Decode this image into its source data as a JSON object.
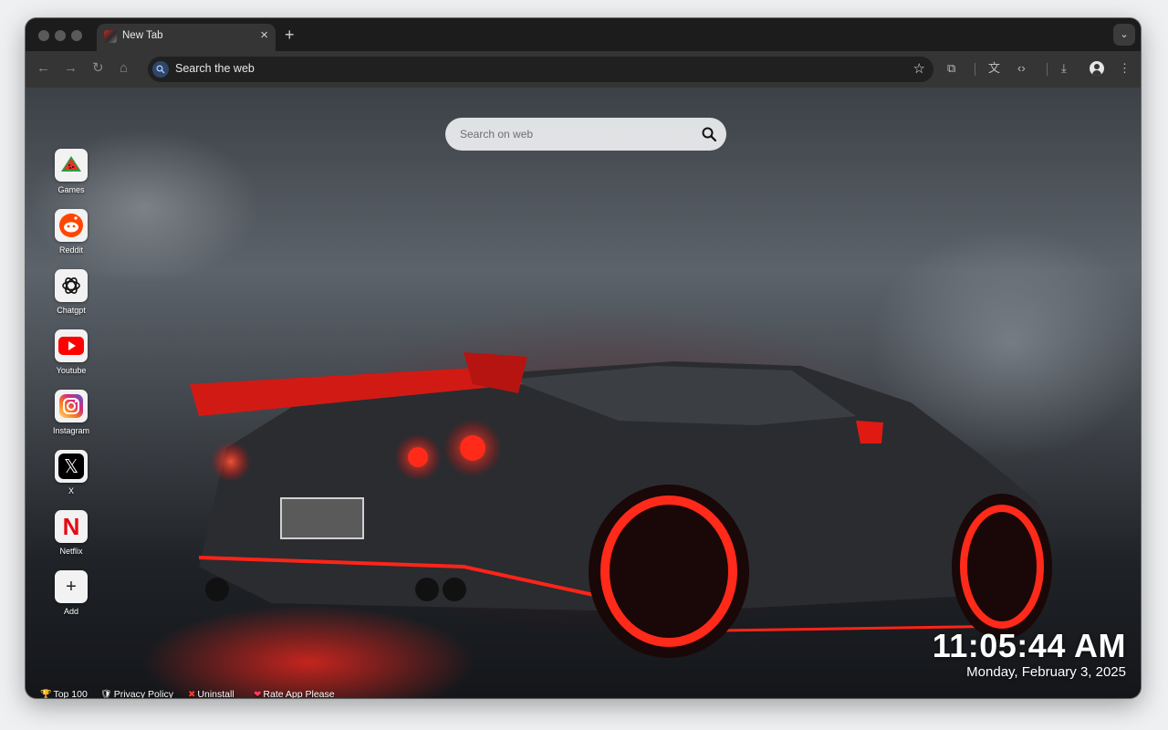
{
  "browser": {
    "tab": {
      "title": "New Tab",
      "close_glyph": "×"
    },
    "new_tab_glyph": "+",
    "tab_search_glyph": "⌄",
    "omnibox": {
      "text": "Search the web",
      "star_glyph": "☆"
    },
    "nav": {
      "back": "←",
      "forward": "→",
      "reload": "↻",
      "home": "⌂"
    },
    "toolbar_icons": {
      "extensions": "⧉",
      "translate": "文",
      "devtools": "‹›",
      "download": "⤓",
      "menu": "⋮"
    }
  },
  "page": {
    "search": {
      "placeholder": "Search on web"
    },
    "shortcuts": [
      {
        "label": "Games",
        "icon": "watermelon-icon"
      },
      {
        "label": "Reddit",
        "icon": "reddit-icon"
      },
      {
        "label": "Chatgpt",
        "icon": "chatgpt-icon"
      },
      {
        "label": "Youtube",
        "icon": "youtube-icon"
      },
      {
        "label": "Instagram",
        "icon": "instagram-icon"
      },
      {
        "label": "X",
        "icon": "x-icon"
      },
      {
        "label": "Netflix",
        "icon": "netflix-icon"
      },
      {
        "label": "Add",
        "icon": "plus-icon"
      }
    ],
    "add_glyph": "+",
    "x_glyph": "𝕏",
    "netflix_glyph": "N",
    "clock": {
      "time": "11:05:44 AM",
      "date": "Monday, February 3, 2025"
    },
    "footer": [
      {
        "label": "Top 100",
        "icon": "🏆"
      },
      {
        "label": "Privacy Policy",
        "icon": "🛡"
      },
      {
        "label": "Uninstall",
        "icon": "✖"
      },
      {
        "label": "Rate App Please",
        "icon": "❤"
      }
    ]
  },
  "colors": {
    "accent_red": "#e8241c",
    "youtube_red": "#ff0000",
    "reddit_orange": "#ff4500",
    "netflix_red": "#e50914"
  }
}
